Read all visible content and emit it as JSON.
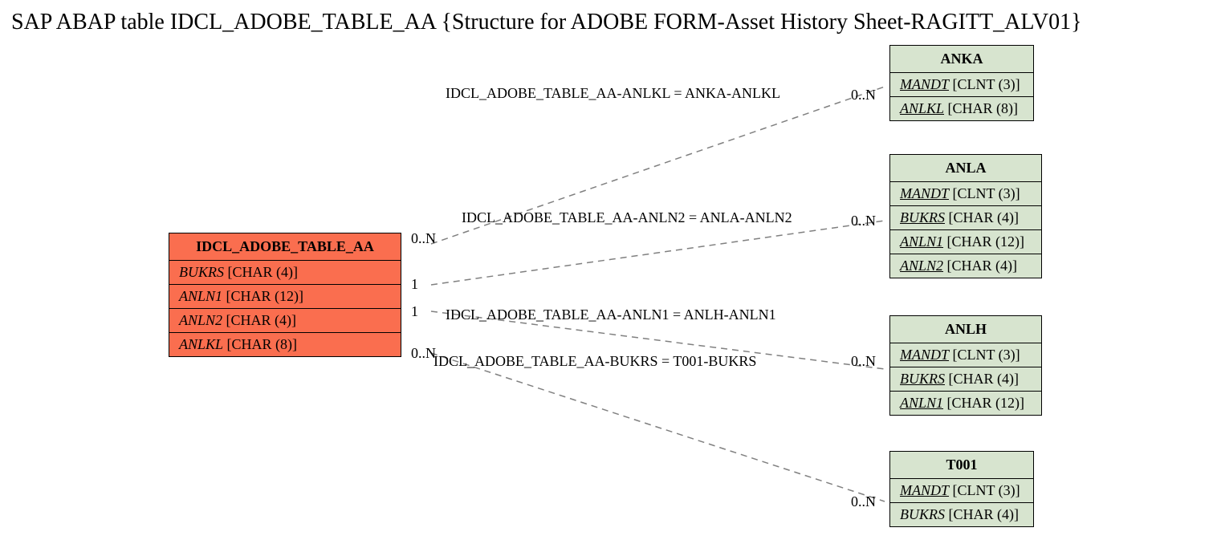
{
  "title": "SAP ABAP table IDCL_ADOBE_TABLE_AA {Structure for ADOBE FORM-Asset History Sheet-RAGITT_ALV01}",
  "colors": {
    "main_bg": "#fa6e4f",
    "ref_bg": "#d7e4cf"
  },
  "main": {
    "name": "IDCL_ADOBE_TABLE_AA",
    "fields": [
      {
        "name": "BUKRS",
        "type": "[CHAR (4)]",
        "key": false
      },
      {
        "name": "ANLN1",
        "type": "[CHAR (12)]",
        "key": false
      },
      {
        "name": "ANLN2",
        "type": "[CHAR (4)]",
        "key": false
      },
      {
        "name": "ANLKL",
        "type": "[CHAR (8)]",
        "key": false
      }
    ]
  },
  "refs": [
    {
      "name": "ANKA",
      "fields": [
        {
          "name": "MANDT",
          "type": "[CLNT (3)]",
          "key": true
        },
        {
          "name": "ANLKL",
          "type": "[CHAR (8)]",
          "key": true
        }
      ]
    },
    {
      "name": "ANLA",
      "fields": [
        {
          "name": "MANDT",
          "type": "[CLNT (3)]",
          "key": true
        },
        {
          "name": "BUKRS",
          "type": "[CHAR (4)]",
          "key": true
        },
        {
          "name": "ANLN1",
          "type": "[CHAR (12)]",
          "key": true
        },
        {
          "name": "ANLN2",
          "type": "[CHAR (4)]",
          "key": true
        }
      ]
    },
    {
      "name": "ANLH",
      "fields": [
        {
          "name": "MANDT",
          "type": "[CLNT (3)]",
          "key": true
        },
        {
          "name": "BUKRS",
          "type": "[CHAR (4)]",
          "key": true
        },
        {
          "name": "ANLN1",
          "type": "[CHAR (12)]",
          "key": true
        }
      ]
    },
    {
      "name": "T001",
      "fields": [
        {
          "name": "MANDT",
          "type": "[CLNT (3)]",
          "key": true
        },
        {
          "name": "BUKRS",
          "type": "[CHAR (4)]",
          "key": false
        }
      ]
    }
  ],
  "relations": [
    {
      "label": "IDCL_ADOBE_TABLE_AA-ANLKL = ANKA-ANLKL",
      "left_card": "0..N",
      "right_card": "0..N"
    },
    {
      "label": "IDCL_ADOBE_TABLE_AA-ANLN2 = ANLA-ANLN2",
      "left_card": "1",
      "right_card": "0..N"
    },
    {
      "label": "IDCL_ADOBE_TABLE_AA-ANLN1 = ANLH-ANLN1",
      "left_card": "1",
      "right_card": "0..N"
    },
    {
      "label": "IDCL_ADOBE_TABLE_AA-BUKRS = T001-BUKRS",
      "left_card": "0..N",
      "right_card": "0..N"
    }
  ]
}
